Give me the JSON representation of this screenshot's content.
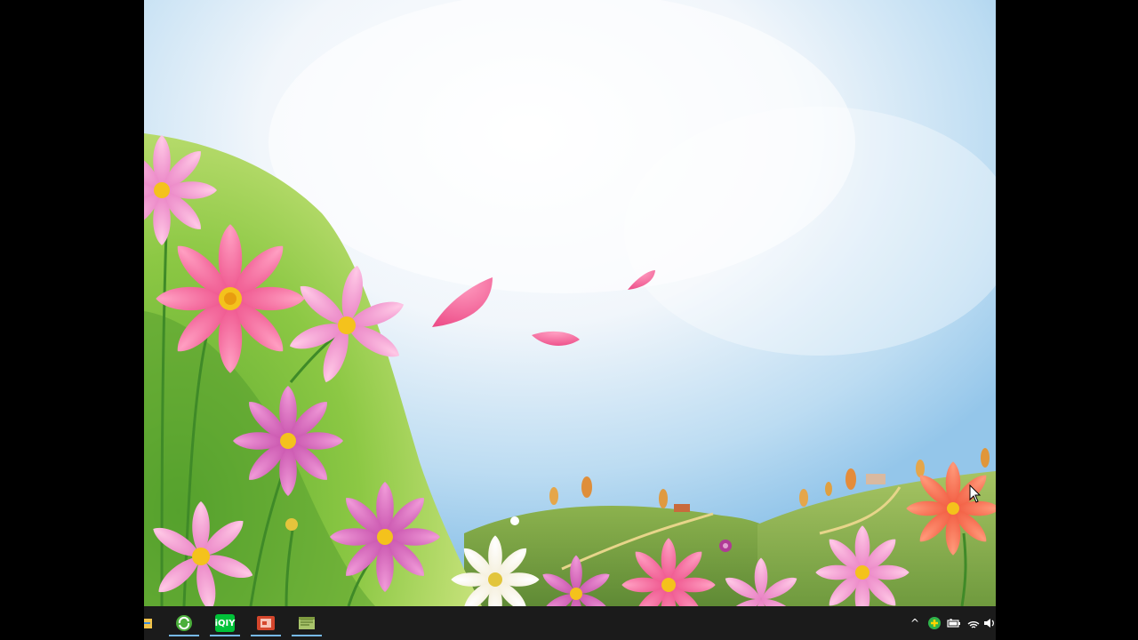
{
  "desktop": {
    "wallpaper": "cosmos-flower-meadow",
    "accent_color": "#76b9ed"
  },
  "taskbar": {
    "background": "#1b1b1b",
    "pinned": [
      {
        "name": "file-explorer-icon",
        "active": false
      },
      {
        "name": "browser-icon",
        "active": true
      },
      {
        "name": "iqiyi-icon",
        "label": "iQIY",
        "active": true
      },
      {
        "name": "presentation-app-icon",
        "active": true
      },
      {
        "name": "notepad-icon",
        "active": true
      }
    ],
    "tray": [
      {
        "name": "show-hidden-icons-chevron-icon",
        "glyph": "^"
      },
      {
        "name": "security-app-plus-icon"
      },
      {
        "name": "battery-icon"
      },
      {
        "name": "wifi-icon"
      },
      {
        "name": "volume-icon"
      }
    ]
  }
}
